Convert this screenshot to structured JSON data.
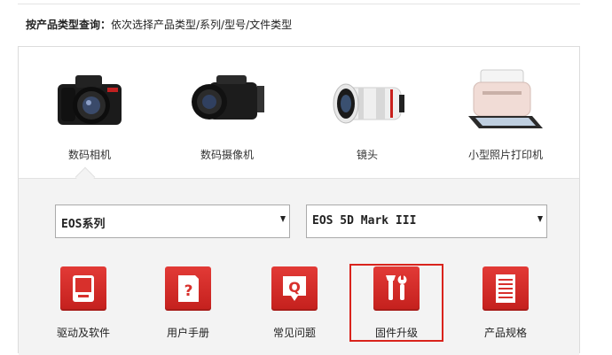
{
  "search": {
    "label": "按产品类型查询：",
    "hint": "依次选择产品类型/系列/型号/文件类型"
  },
  "categories": [
    {
      "label": "数码相机",
      "icon": "dslr-camera-icon"
    },
    {
      "label": "数码摄像机",
      "icon": "camcorder-icon"
    },
    {
      "label": "镜头",
      "icon": "lens-icon"
    },
    {
      "label": "小型照片打印机",
      "icon": "photo-printer-icon"
    }
  ],
  "selects": {
    "series": "EOS系列",
    "model": "EOS 5D Mark III"
  },
  "tools": [
    {
      "label": "驱动及软件",
      "icon": "driver-software-icon"
    },
    {
      "label": "用户手册",
      "icon": "user-manual-icon"
    },
    {
      "label": "常见问题",
      "icon": "faq-icon"
    },
    {
      "label": "固件升级",
      "icon": "firmware-tools-icon",
      "selected": true
    },
    {
      "label": "产品规格",
      "icon": "spec-sheet-icon"
    }
  ],
  "colors": {
    "accent": "#d9231c",
    "panel_bg": "#f3f3f3"
  }
}
